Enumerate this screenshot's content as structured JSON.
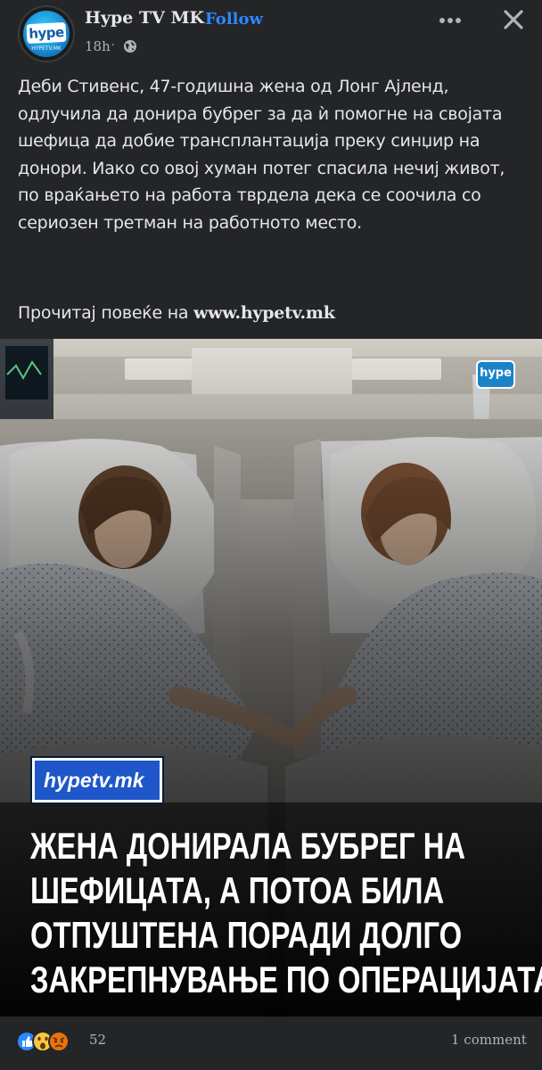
{
  "post": {
    "page_name": "Hype TV MK",
    "follow_label": "Follow",
    "separator": "·",
    "time": "18h",
    "avatar": {
      "logo_word": "hype",
      "logo_sub": "HYPETV.MK"
    },
    "body": "Деби Стивенс, 47-годишна жена од Лонг Ајленд, одлучила да донира бубрег за да ѝ помогне на својата шефица да добие трансплантација преку синџир на донори. Иако со овој хуман потег спасила нечиј живот, по враќањето на работа тврдела дека се соочила со сериозен третман на работното место.",
    "read_more_prefix": "Прочитај повеќе на",
    "read_more_link": "www.hypetv.mk"
  },
  "photo": {
    "badge_text": "hype",
    "site_tag": "hypetv.mk",
    "headline_lines": [
      "ЖЕНА ДОНИРАЛА БУБРЕГ НА",
      "ШЕФИЦАТА, А ПОТОА БИЛА",
      "ОТПУШТЕНА ПОРАДИ ДОЛГО",
      "ЗАКРЕПНУВАЊЕ ПО ОПЕРАЦИЈАТА!"
    ]
  },
  "footer": {
    "reaction_count": "52",
    "comment_count": "1 comment",
    "reactions": [
      "like-icon",
      "wow-icon",
      "angry-icon"
    ]
  },
  "icons": {
    "privacy": "globe-icon",
    "menu": "more-options-icon",
    "dismiss": "close-icon"
  },
  "colors": {
    "background": "#242526",
    "text": "#e4e6eb",
    "muted": "#b0b3b8",
    "link_blue": "#2d88ff",
    "brand_blue": "#1f56c9"
  }
}
